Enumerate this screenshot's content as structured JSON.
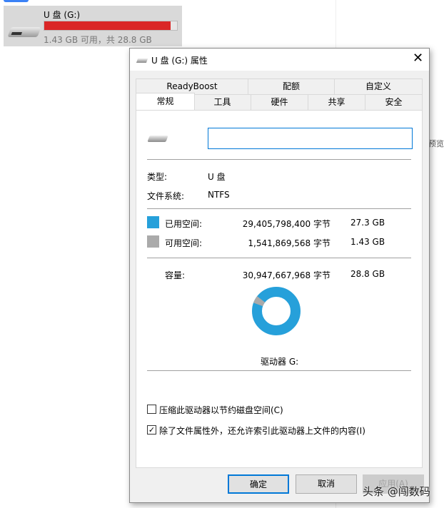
{
  "explorer": {
    "drive_name": "U 盘 (G:)",
    "drive_summary": "1.43 GB 可用，共 28.8 GB",
    "used_fraction": 0.95,
    "bar_color": "#da2626",
    "side_text": "预览"
  },
  "dialog": {
    "title": "U 盘 (G:) 属性",
    "tabs_row1": [
      "ReadyBoost",
      "配额",
      "自定义"
    ],
    "tabs_row2": [
      "常规",
      "工具",
      "硬件",
      "共享",
      "安全"
    ],
    "name_value": "",
    "type_label": "类型:",
    "type_value": "U 盘",
    "fs_label": "文件系统:",
    "fs_value": "NTFS",
    "used_label": "已用空间:",
    "used_bytes": "29,405,798,400 字节",
    "used_size": "27.3 GB",
    "used_color": "#26a0da",
    "free_label": "可用空间:",
    "free_bytes": "1,541,869,568 字节",
    "free_size": "1.43 GB",
    "free_color": "#aaaaaa",
    "cap_label": "容量:",
    "cap_bytes": "30,947,667,968 字节",
    "cap_size": "28.8 GB",
    "drive_label": "驱动器 G:",
    "compress_label": "压缩此驱动器以节约磁盘空间(C)",
    "compress_checked": false,
    "index_label": "除了文件属性外，还允许索引此驱动器上文件的内容(I)",
    "index_checked": true,
    "ok": "确定",
    "cancel": "取消",
    "apply": "应用(A)"
  },
  "watermark": "头条 @闯数码"
}
